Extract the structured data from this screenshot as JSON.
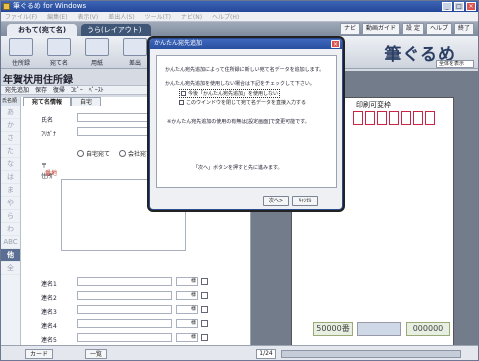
{
  "window": {
    "title": "筆ぐるめ for Windows"
  },
  "menu": [
    "ファイル(F)",
    "編集(E)",
    "表示(V)",
    "差出人(S)",
    "ツール(T)",
    "ナビ(N)",
    "ヘルプ(H)"
  ],
  "tabs": {
    "active": "おもて(宛て名)",
    "other": "うら(レイアウト)"
  },
  "toolbar_right": [
    "ナビ",
    "動画ガイド",
    "設 定",
    "ヘルプ",
    "終了"
  ],
  "tools": [
    "住所録",
    "宛て名",
    "用紙",
    "差出"
  ],
  "brand": "筆ぐるめ",
  "view_select": "全体を表示",
  "page_title": "年賀状用住所録",
  "minitool": [
    "宛先追加",
    "保存",
    "復帰",
    "ｺﾋﾟｰ",
    "ﾍﾟｰｽﾄ"
  ],
  "sidebar": {
    "head": "氏名順",
    "kana": [
      "あ",
      "か",
      "さ",
      "た",
      "な",
      "は",
      "ま",
      "や",
      "ら",
      "わ",
      "ABC",
      "他",
      "全"
    ],
    "selected_index": 11
  },
  "form_tabs": [
    "宛て名情報",
    "自宅"
  ],
  "fields": {
    "name": "氏名",
    "kana": "ﾌﾘｶﾞﾅ",
    "postal": "〒",
    "address": "住所",
    "addr_tag": "番地"
  },
  "radios": [
    "自宅宛て",
    "会社宛て"
  ],
  "rows": [
    "連名1",
    "連名2",
    "連名3",
    "連名4",
    "連名5"
  ],
  "row_dd": "様",
  "preview": {
    "header": "印刷可変枠",
    "lottery_left": "50000番",
    "lottery_right": "000000"
  },
  "status": {
    "left_btn": "カード",
    "right_btn": "一覧",
    "page": "1/24"
  },
  "dialog": {
    "title": "かんたん宛先追加",
    "line1": "かんたん宛先追加によって住所録に新しい宛て名データを追加します。",
    "line2": "かんたん宛先追加を使用しない場合は下記をチェックして下さい。",
    "check1": "今後「かんたん宛先追加」を使用しない",
    "check2": "このウインドウを閉じて宛て名データを直接入力する",
    "note": "※かんたん宛先追加の使用の有無は[設定画面]で変更可能です。",
    "hint": "「次へ」ボタンを押すと先に進みます。",
    "next": "次へ>",
    "cancel": "ｷｬﾝｾﾙ"
  }
}
